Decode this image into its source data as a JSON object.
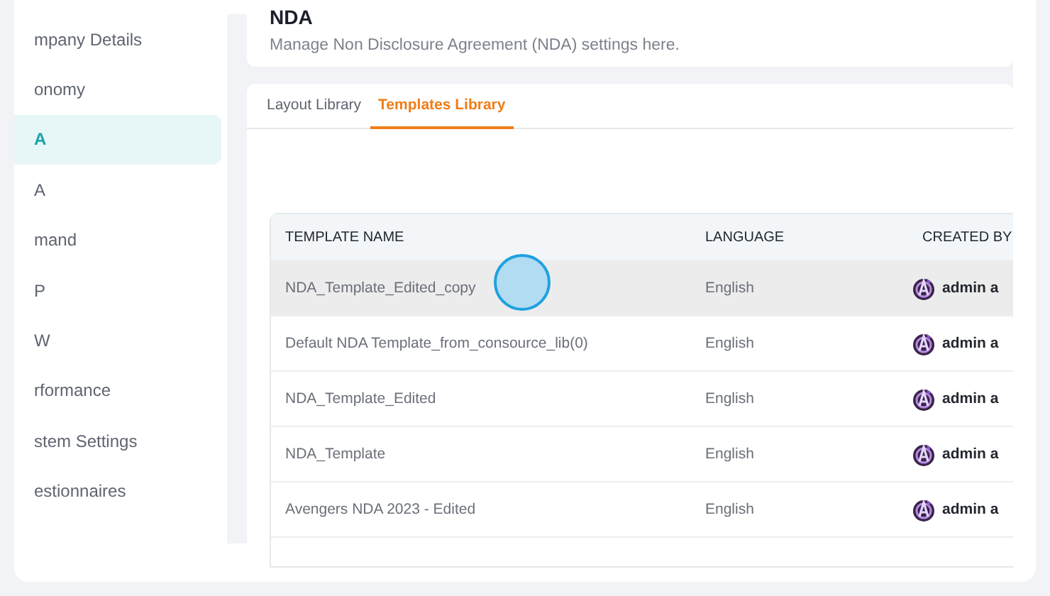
{
  "sidebar": {
    "items": [
      {
        "label": "mpany Details",
        "selected": false
      },
      {
        "label": "onomy",
        "selected": false
      },
      {
        "label": "A",
        "selected": true
      },
      {
        "label": "A",
        "selected": false
      },
      {
        "label": "mand",
        "selected": false
      },
      {
        "label": "P",
        "selected": false
      },
      {
        "label": "W",
        "selected": false
      },
      {
        "label": "rformance",
        "selected": false
      },
      {
        "label": "stem Settings",
        "selected": false
      },
      {
        "label": "estionnaires",
        "selected": false
      }
    ]
  },
  "header": {
    "title": "NDA",
    "subtitle": "Manage Non Disclosure Agreement (NDA) settings here."
  },
  "tabs": [
    {
      "label": "Layout Library",
      "selected": false
    },
    {
      "label": "Templates Library",
      "selected": true
    }
  ],
  "table": {
    "columns": [
      "TEMPLATE NAME",
      "LANGUAGE",
      "CREATED BY"
    ],
    "rows": [
      {
        "name": "NDA_Template_Edited_copy",
        "language": "English",
        "created_by": "admin a",
        "highlighted": true
      },
      {
        "name": "Default NDA Template_from_consource_lib(0)",
        "language": "English",
        "created_by": "admin a",
        "highlighted": false
      },
      {
        "name": "NDA_Template_Edited",
        "language": "English",
        "created_by": "admin a",
        "highlighted": false
      },
      {
        "name": "NDA_Template",
        "language": "English",
        "created_by": "admin a",
        "highlighted": false
      },
      {
        "name": "Avengers NDA 2023 - Edited",
        "language": "English",
        "created_by": "admin a",
        "highlighted": false
      }
    ]
  }
}
